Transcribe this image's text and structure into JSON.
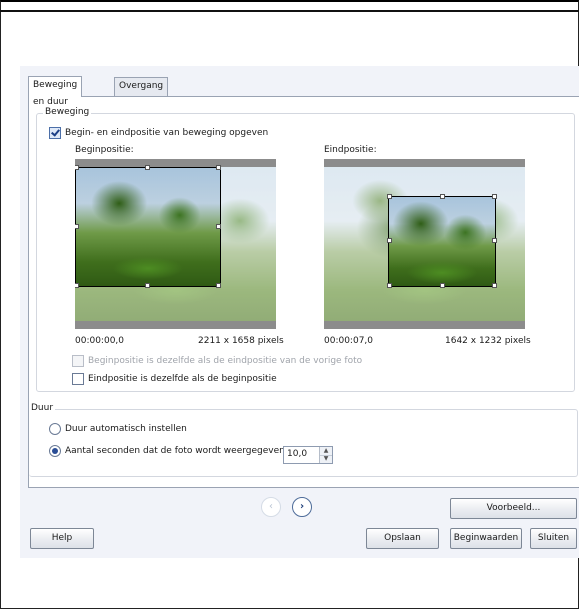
{
  "tabs": [
    "Beweging en duur",
    "Overgang"
  ],
  "beweging": {
    "legend": "Beweging",
    "specify_label": "Begin- en eindpositie van beweging opgeven",
    "begin_label": "Beginpositie:",
    "end_label": "Eindpositie:",
    "begin_time": "00:00:00,0",
    "begin_size": "2211 x 1658 pixels",
    "end_time": "00:00:07,0",
    "end_size": "1642 x 1232 pixels",
    "same_prev_label": "Beginpositie is dezelfde als de eindpositie van de vorige foto",
    "same_begin_label": "Eindpositie is dezelfde als de beginpositie"
  },
  "duur": {
    "legend": "Duur",
    "auto_label": "Duur automatisch instellen",
    "seconds_label": "Aantal seconden dat de foto wordt weergegeven",
    "seconds_value": "10,0"
  },
  "buttons": {
    "preview": "Voorbeeld...",
    "help": "Help",
    "save": "Opslaan",
    "defaults": "Beginwaarden",
    "close": "Sluiten"
  },
  "icons": {
    "prev": "chevron-left-icon",
    "next": "chevron-right-icon",
    "spin_up": "triangle-up-icon",
    "spin_down": "triangle-down-icon"
  }
}
